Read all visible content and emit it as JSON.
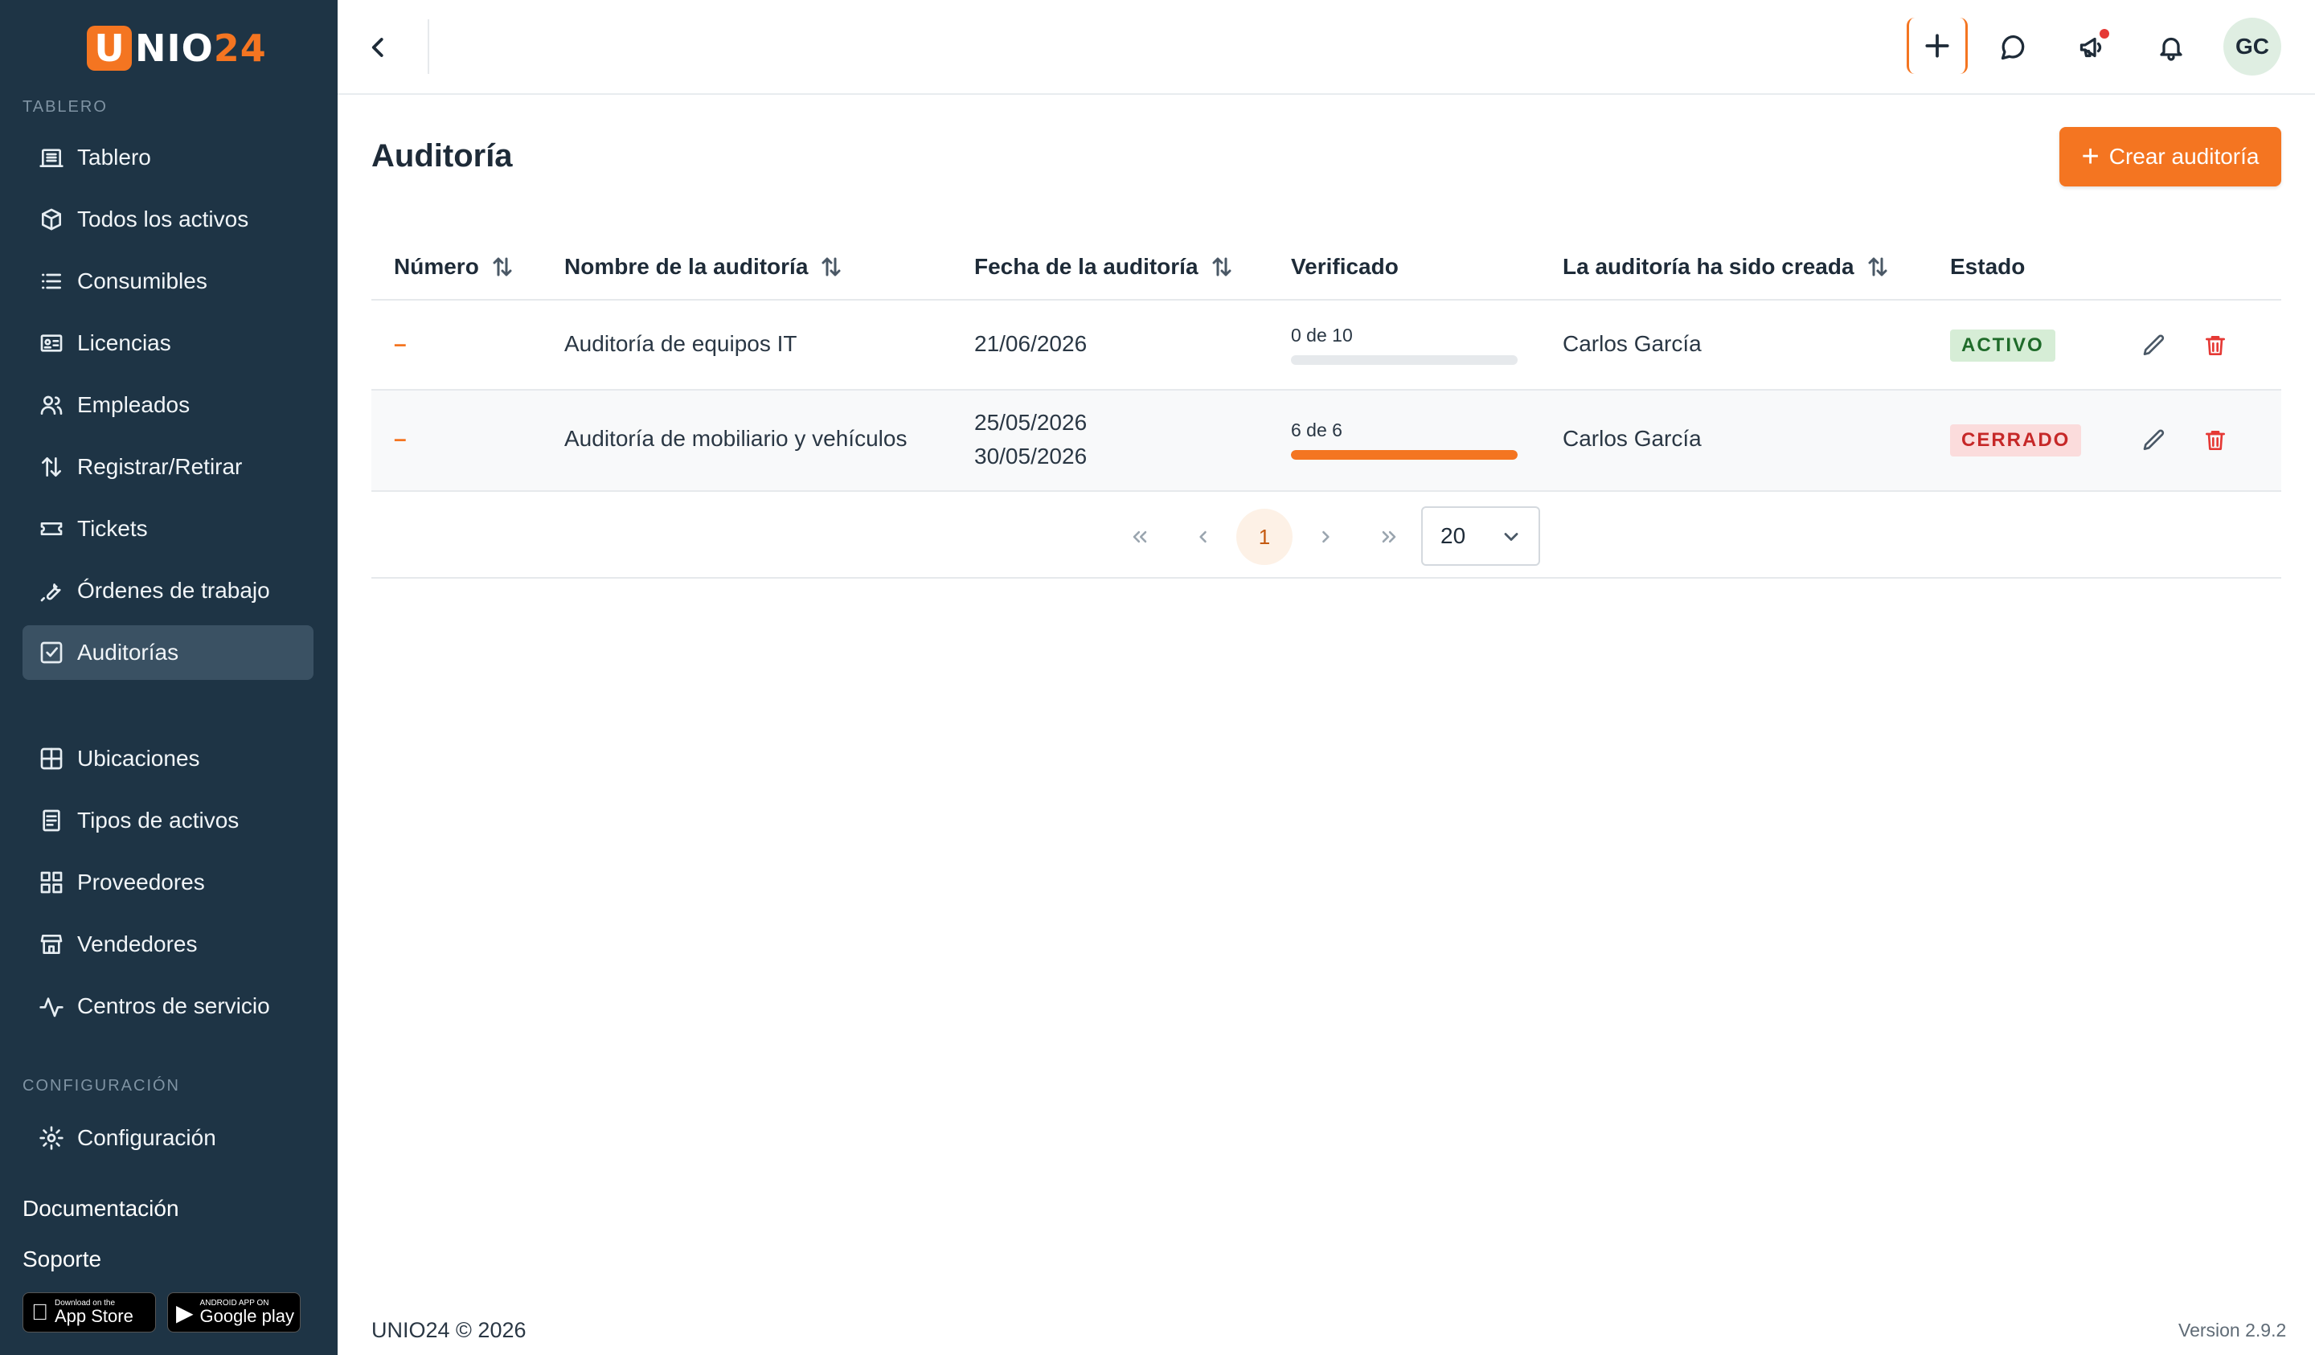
{
  "brand": {
    "logo_letter": "U",
    "logo_rest_white": "NIO",
    "logo_rest_orange": "24"
  },
  "colors": {
    "sidebar_bg": "#1e3445",
    "accent": "#f47521",
    "active_item": "#3a5163",
    "status_active": "#1f6b2a",
    "status_closed": "#c62828"
  },
  "sidebar": {
    "section_dashboard": "TABLERO",
    "items": [
      {
        "label": "Tablero",
        "icon": "building-icon"
      },
      {
        "label": "Todos los activos",
        "icon": "box-icon"
      },
      {
        "label": "Consumibles",
        "icon": "list-icon"
      },
      {
        "label": "Licencias",
        "icon": "id-card-icon"
      },
      {
        "label": "Empleados",
        "icon": "users-icon"
      },
      {
        "label": "Registrar/Retirar",
        "icon": "arrows-updown-icon"
      },
      {
        "label": "Tickets",
        "icon": "ticket-icon"
      },
      {
        "label": "Órdenes de trabajo",
        "icon": "wrench-icon"
      },
      {
        "label": "Auditorías",
        "icon": "checkbox-icon",
        "active": true
      }
    ],
    "items2": [
      {
        "label": "Ubicaciones",
        "icon": "grid-icon"
      },
      {
        "label": "Tipos de activos",
        "icon": "document-icon"
      },
      {
        "label": "Proveedores",
        "icon": "apps-icon"
      },
      {
        "label": "Vendedores",
        "icon": "store-icon"
      },
      {
        "label": "Centros de servicio",
        "icon": "activity-icon"
      }
    ],
    "section_config": "CONFIGURACIÓN",
    "config_item": {
      "label": "Configuración",
      "icon": "gear-icon"
    },
    "documentation": "Documentación",
    "support": "Soporte",
    "app_store": {
      "small": "Download on the",
      "big": "App Store"
    },
    "google_play": {
      "small": "ANDROID APP ON",
      "big": "Google play"
    }
  },
  "topbar": {
    "avatar_initials": "GC"
  },
  "page": {
    "title": "Auditoría",
    "create_button": "Crear auditoría"
  },
  "table": {
    "columns": [
      "Número",
      "Nombre de la auditoría",
      "Fecha de la auditoría",
      "Verificado",
      "La auditoría ha sido creada",
      "Estado"
    ],
    "rows": [
      {
        "number": "–",
        "name": "Auditoría de equipos IT",
        "date1": "21/06/2026",
        "date2": "",
        "verified_label": "0 de 10",
        "verified_fraction": 0.0,
        "creator": "Carlos García",
        "status": "ACTIVO"
      },
      {
        "number": "–",
        "name": "Auditoría de mobiliario y vehículos",
        "date1": "25/05/2026",
        "date2": "30/05/2026",
        "verified_label": "6 de 6",
        "verified_fraction": 1.0,
        "creator": "Carlos García",
        "status": "CERRADO"
      }
    ]
  },
  "pagination": {
    "current_page": "1",
    "page_size": "20"
  },
  "footer": {
    "copyright": "UNIO24 © 2026",
    "version": "Version 2.9.2"
  }
}
